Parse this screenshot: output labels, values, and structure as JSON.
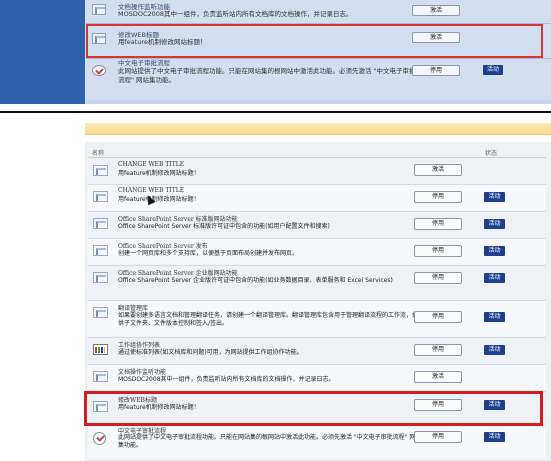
{
  "top": {
    "rows": [
      {
        "title": "文档操作监听功能",
        "desc": "MOSDOC2008其中一组件，负责监听站内所有文档库的文档操作，并记录日志。",
        "button": "激活",
        "badge": ""
      },
      {
        "title": "修改WEB标题",
        "desc": "用feature机制修改网站标题！",
        "button": "激活",
        "badge": ""
      },
      {
        "title": "中文电子审批流程",
        "desc": "此网站提供了中文电子审批流程功能。只能在网站集的根网站中激活此功能。必须先激活 \"中文电子审批流程\" 网站集功能。",
        "button": "停用",
        "badge": "活动"
      }
    ]
  },
  "columns": {
    "name": "名称",
    "status": "状态"
  },
  "features": [
    {
      "title": "CHANGE WEB TITLE",
      "desc": "用feature机制修改网站标题！",
      "button": "激活",
      "badge": ""
    },
    {
      "title": "CHANGE WEB TITLE",
      "desc": "用feature机制修改网站标题！",
      "button": "停用",
      "badge": "活动"
    },
    {
      "title": "Office SharePoint Server 标准版网站功能",
      "desc": "Office SharePoint Server 标准版许可证中包含的功能(如用户配置文件和搜索)",
      "button": "停用",
      "badge": "活动"
    },
    {
      "title": "Office SharePoint Server 发布",
      "desc": "创建一个网页库和多个支持库，以便基于页面布局创建并发布网页。",
      "button": "停用",
      "badge": "活动"
    },
    {
      "title": "Office SharePoint Server 企业版网站功能",
      "desc": "Office SharePoint Server 企业版许可证中包含的功能(如业务数据目录、表单服务和 Excel Services)",
      "button": "停用",
      "badge": "活动"
    },
    {
      "title": "翻译管理库",
      "desc": "如果要创建多语言文档和管理翻译任务，请创建一个翻译管理库。翻译管理库包含用于管理翻译流程的工作流，并提供子文件夹、文件版本控制和签入/签出。",
      "button": "停用",
      "badge": "活动"
    },
    {
      "title": "工作组协作列表",
      "desc": "通过使标准列表(如文档库和问题)可用，为网站提供工作组协作功能。",
      "button": "停用",
      "badge": "活动"
    },
    {
      "title": "文档操作监听功能",
      "desc": "MOSDOC2008其中一组件，负责监听站内所有文档库的文档操作，并记录日志。",
      "button": "激活",
      "badge": ""
    },
    {
      "title": "修改WEB标题",
      "desc": "用feature机制修改网站标题！",
      "button": "停用",
      "badge": "活动"
    },
    {
      "title": "中文电子审批流程",
      "desc": "此网站提供了中文电子审批流程功能。只能在网站集的根网站中激活此功能。必须先激活 \"中文电子审批流程\" 网站集功能。",
      "button": "停用",
      "badge": "活动"
    }
  ],
  "colors": {
    "accent": "#1d3f8f",
    "highlight": "#d11f1f",
    "topBackground": "#2f62ad"
  }
}
